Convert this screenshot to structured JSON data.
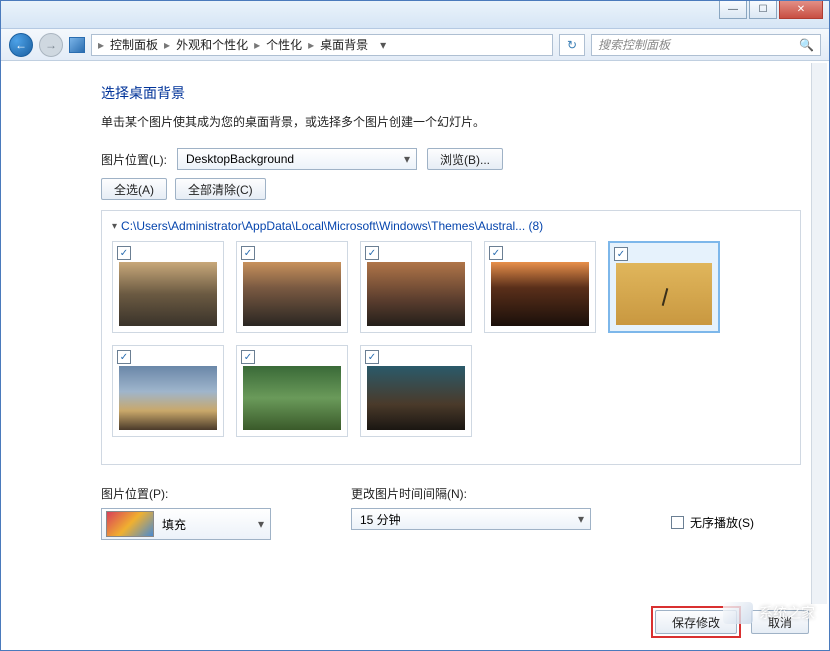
{
  "titlebar": {
    "min": "—",
    "max": "☐",
    "close": "✕"
  },
  "nav": {
    "back": "←",
    "fwd": "→",
    "crumbs": [
      "控制面板",
      "外观和个性化",
      "个性化",
      "桌面背景"
    ],
    "sep": "▸",
    "drop": "▾",
    "refresh": "↻",
    "search_placeholder": "搜索控制面板"
  },
  "page": {
    "heading": "选择桌面背景",
    "desc": "单击某个图片使其成为您的桌面背景，或选择多个图片创建一个幻灯片。",
    "loc_label": "图片位置(L):",
    "loc_value": "DesktopBackground",
    "browse": "浏览(B)...",
    "select_all": "全选(A)",
    "clear_all": "全部清除(C)"
  },
  "gallery": {
    "path": "C:\\Users\\Administrator\\AppData\\Local\\Microsoft\\Windows\\Themes\\Austral... (8)",
    "check": "✓",
    "items": [
      {
        "cls": "i-beach1",
        "sel": false
      },
      {
        "cls": "i-beach2",
        "sel": false
      },
      {
        "cls": "i-beach3",
        "sel": false
      },
      {
        "cls": "i-dune1",
        "sel": false
      },
      {
        "cls": "i-dune2",
        "sel": true
      },
      {
        "cls": "i-sky",
        "sel": false
      },
      {
        "cls": "i-tree",
        "sel": false
      },
      {
        "cls": "i-rock",
        "sel": false
      }
    ]
  },
  "bottom": {
    "pos_label": "图片位置(P):",
    "pos_value": "填充",
    "interval_label": "更改图片时间间隔(N):",
    "interval_value": "15 分钟",
    "shuffle": "无序播放(S)"
  },
  "footer": {
    "save": "保存修改",
    "cancel": "取消"
  },
  "watermark": {
    "text": "系统之家",
    "sub": "XITONGZHIJIA.NET"
  }
}
